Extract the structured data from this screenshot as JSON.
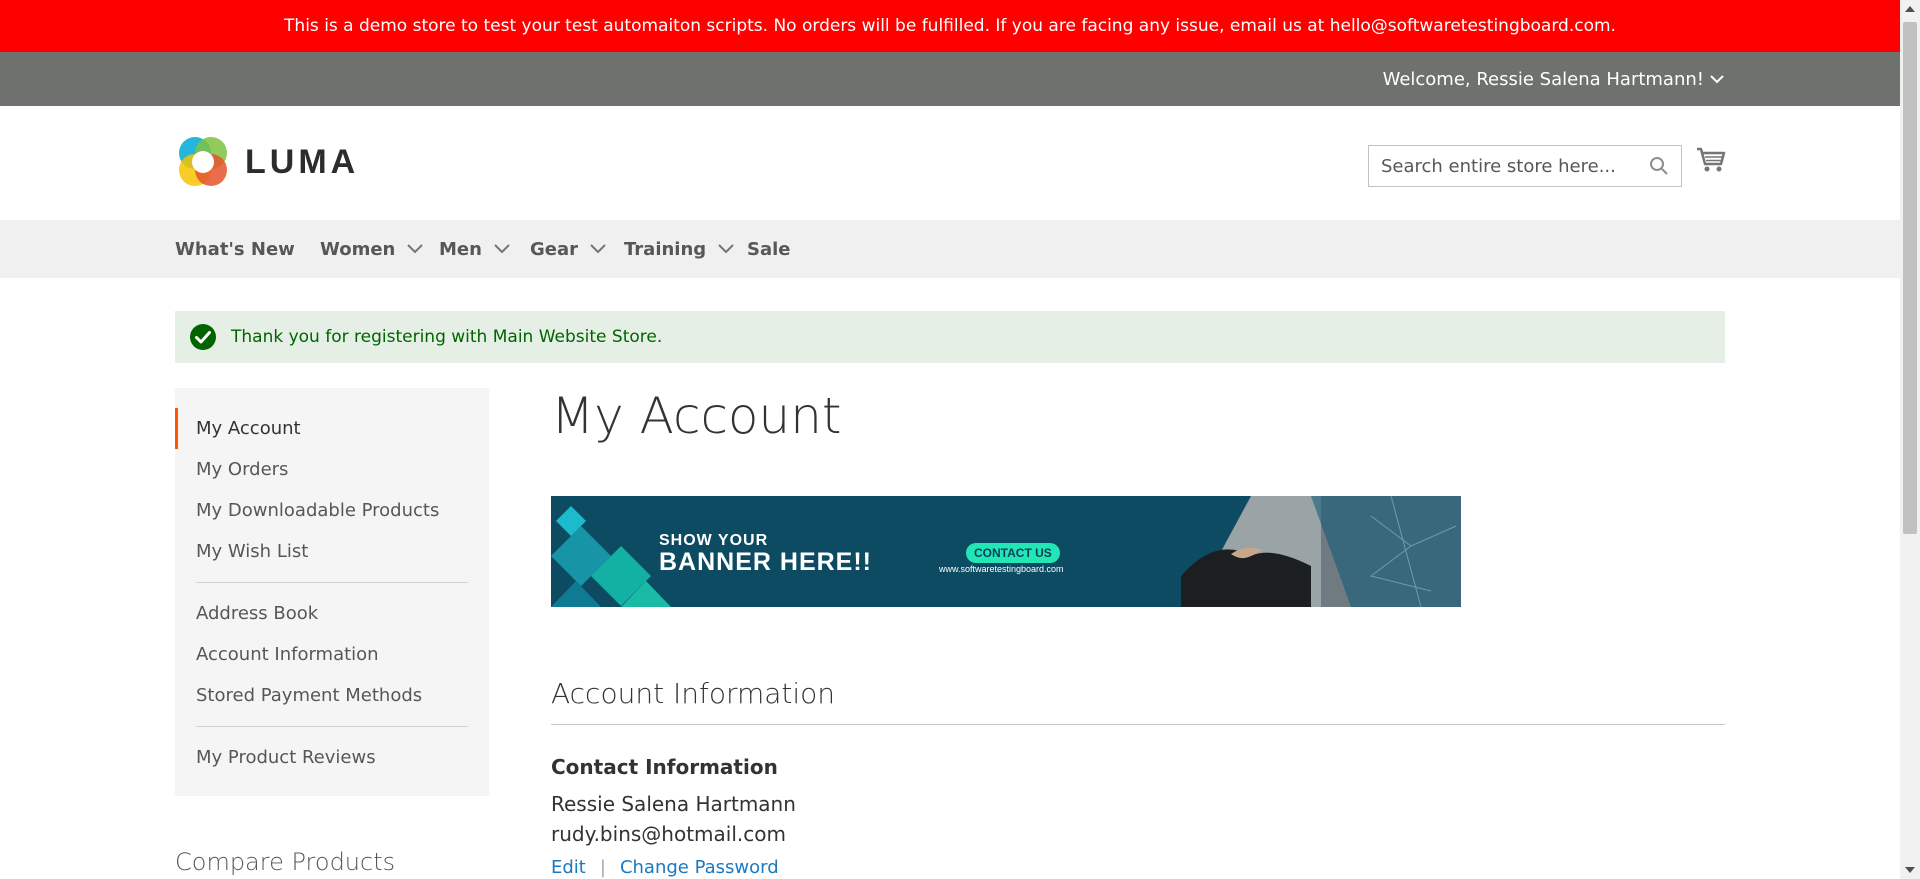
{
  "demo_notice": "This is a demo store to test your test automaiton scripts. No orders will be fulfilled. If you are facing any issue, email us at hello@softwaretestingboard.com.",
  "header": {
    "welcome": "Welcome, Ressie Salena Hartmann!",
    "logo_text": "LUMA",
    "search_placeholder": "Search entire store here...",
    "search_icon": "search-icon",
    "cart_icon": "cart-icon"
  },
  "nav": {
    "items": [
      {
        "label": "What's New",
        "dropdown": false
      },
      {
        "label": "Women",
        "dropdown": true
      },
      {
        "label": "Men",
        "dropdown": true
      },
      {
        "label": "Gear",
        "dropdown": true
      },
      {
        "label": "Training",
        "dropdown": true
      },
      {
        "label": "Sale",
        "dropdown": false
      }
    ]
  },
  "message": {
    "text": "Thank you for registering with Main Website Store.",
    "icon": "check-circle-icon"
  },
  "sidebar": {
    "items": [
      {
        "label": "My Account"
      },
      {
        "label": "My Orders"
      },
      {
        "label": "My Downloadable Products"
      },
      {
        "label": "My Wish List"
      },
      {
        "label": "Address Book"
      },
      {
        "label": "Account Information"
      },
      {
        "label": "Stored Payment Methods"
      },
      {
        "label": "My Product Reviews"
      }
    ],
    "compare_title": "Compare Products"
  },
  "main": {
    "page_title": "My Account",
    "banner": {
      "line1": "SHOW YOUR",
      "line2": "BANNER HERE!!",
      "contact_button": "CONTACT US",
      "website": "www.softwaretestingboard.com"
    },
    "section_title": "Account Information",
    "contact": {
      "title": "Contact Information",
      "name": "Ressie Salena Hartmann",
      "email": "rudy.bins@hotmail.com",
      "edit": "Edit",
      "separator": "|",
      "change_password": "Change Password"
    }
  },
  "colors": {
    "demo_bar": "#ff0000",
    "panel_bar": "#6e716e",
    "nav_bg": "#f0f0f0",
    "message_bg": "#e5efe5",
    "message_text": "#006400",
    "accent": "#ff5501",
    "link": "#1979c3"
  }
}
